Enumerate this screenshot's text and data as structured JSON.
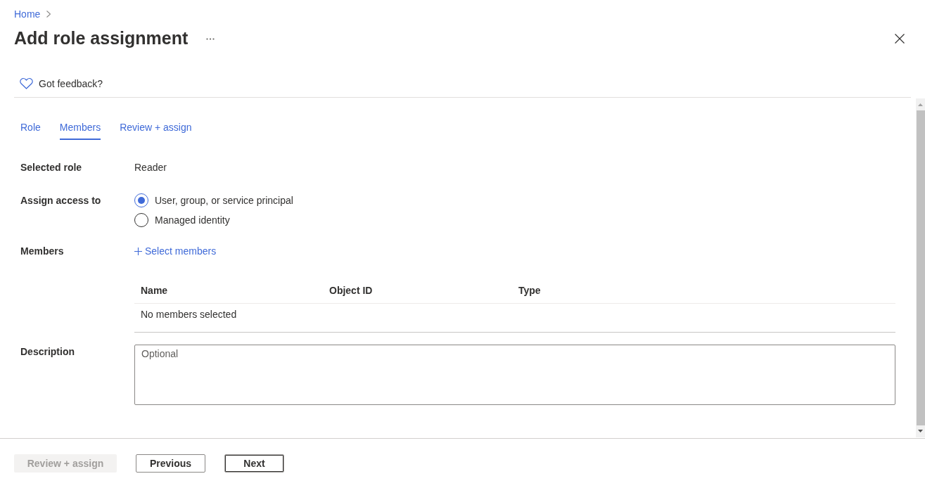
{
  "breadcrumb": [
    {
      "label": "Home"
    }
  ],
  "title": "Add role assignment",
  "feedback": {
    "label": "Got feedback?"
  },
  "tabs": [
    {
      "label": "Role",
      "selected": false
    },
    {
      "label": "Members",
      "selected": true
    },
    {
      "label": "Review + assign",
      "selected": false
    }
  ],
  "fields": [
    {
      "kind": "text",
      "label": "Selected role",
      "value": "Reader"
    },
    {
      "kind": "radio",
      "label": "Assign access to",
      "options": [
        {
          "label": "User, group, or service principal",
          "selected": true
        },
        {
          "label": "Managed identity",
          "selected": false
        }
      ]
    },
    {
      "kind": "members",
      "label": "Members",
      "action": "Select members",
      "table": {
        "columns": [
          "Name",
          "Object ID",
          "Type"
        ],
        "empty_message": "No members selected"
      }
    },
    {
      "kind": "textarea",
      "label": "Description",
      "placeholder": "Optional"
    }
  ],
  "footer_buttons": [
    {
      "label": "Review + assign",
      "disabled": true,
      "focused": false
    },
    {
      "label": "Previous",
      "disabled": false,
      "focused": false
    },
    {
      "label": "Next",
      "disabled": false,
      "focused": true
    }
  ]
}
